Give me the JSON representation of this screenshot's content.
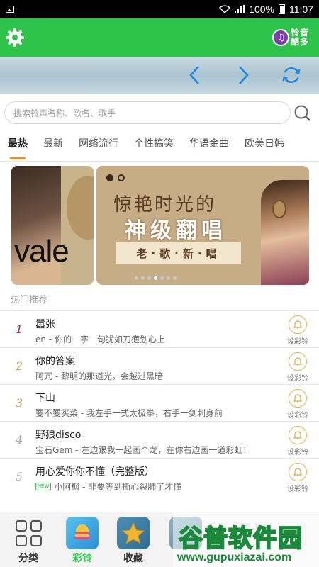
{
  "status_bar": {
    "battery": "100%",
    "time": "11:07"
  },
  "header": {
    "logo_text": "铃音酷多",
    "logo_line1": "铃音",
    "logo_line2": "酷多"
  },
  "search": {
    "placeholder": "搜索铃声名称、歌名、歌手"
  },
  "tabs": [
    {
      "label": "最热",
      "active": true
    },
    {
      "label": "最新",
      "active": false
    },
    {
      "label": "网络流行",
      "active": false
    },
    {
      "label": "个性搞笑",
      "active": false
    },
    {
      "label": "华语金曲",
      "active": false
    },
    {
      "label": "欧美日韩",
      "active": false
    }
  ],
  "banner": {
    "left_text": "vale",
    "title_line1": "惊艳时光的",
    "title_line2": "神级翻唱",
    "subtitle": "老·歌·新·唱",
    "page_count": 7,
    "current_page": 4
  },
  "section_title": "热门推荐",
  "set_ring_label": "设彩铃",
  "songs": [
    {
      "rank": "1",
      "title": "嚣张",
      "subtitle": "en - 你的一字一句犹如刀疤划心上",
      "is_new": false
    },
    {
      "rank": "2",
      "title": "你的答案",
      "subtitle": "阿冗 - 黎明的那道光，会越过黑暗",
      "is_new": false
    },
    {
      "rank": "3",
      "title": "下山",
      "subtitle": "要不要买菜 - 我左手一式太极拳，右手一剑刺身前",
      "is_new": false
    },
    {
      "rank": "4",
      "title": "野狼disco",
      "subtitle": "宝石Gem - 左边跟我一起画个龙，在你右边画一道彩虹！",
      "is_new": false
    },
    {
      "rank": "5",
      "title": "用心爱你你不懂（完整版）",
      "subtitle": "小阿枫 - 非要等到撕心裂肺了才懂",
      "is_new": true,
      "new_badge": "NEW"
    }
  ],
  "bottom_nav": [
    {
      "label": "分类",
      "active": false
    },
    {
      "label": "彩铃",
      "active": true
    },
    {
      "label": "收藏",
      "active": false
    }
  ],
  "watermark": {
    "main": "谷普软件园",
    "url": "www.gupuxiazai.com"
  },
  "colors": {
    "primary_green": "#2ec34a",
    "accent_orange": "#f08b1c",
    "nav_blue": "#1e86e0",
    "rank_red": "#c0282d",
    "rank_gold": "#c7a04b"
  }
}
